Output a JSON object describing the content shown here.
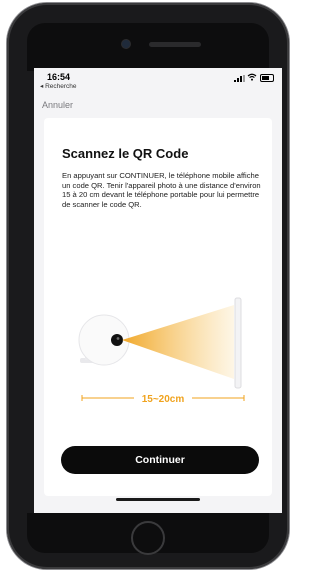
{
  "status_bar": {
    "time": "16:54",
    "back_app": "◂ Recherche"
  },
  "nav": {
    "cancel_label": "Annuler"
  },
  "card": {
    "title": "Scannez le QR Code",
    "description": "En appuyant sur CONTINUER, le téléphone mobile affiche un code QR. Tenir l'appareil photo à une distance d'environ 15 à 20 cm devant le téléphone portable pour lui permettre de scanner le code QR.",
    "distance_label": "15~20cm",
    "continue_label": "Continuer"
  },
  "colors": {
    "accent": "#f0a31e",
    "button_bg": "#0b0b0b",
    "screen_bg": "#f4f4f6"
  }
}
